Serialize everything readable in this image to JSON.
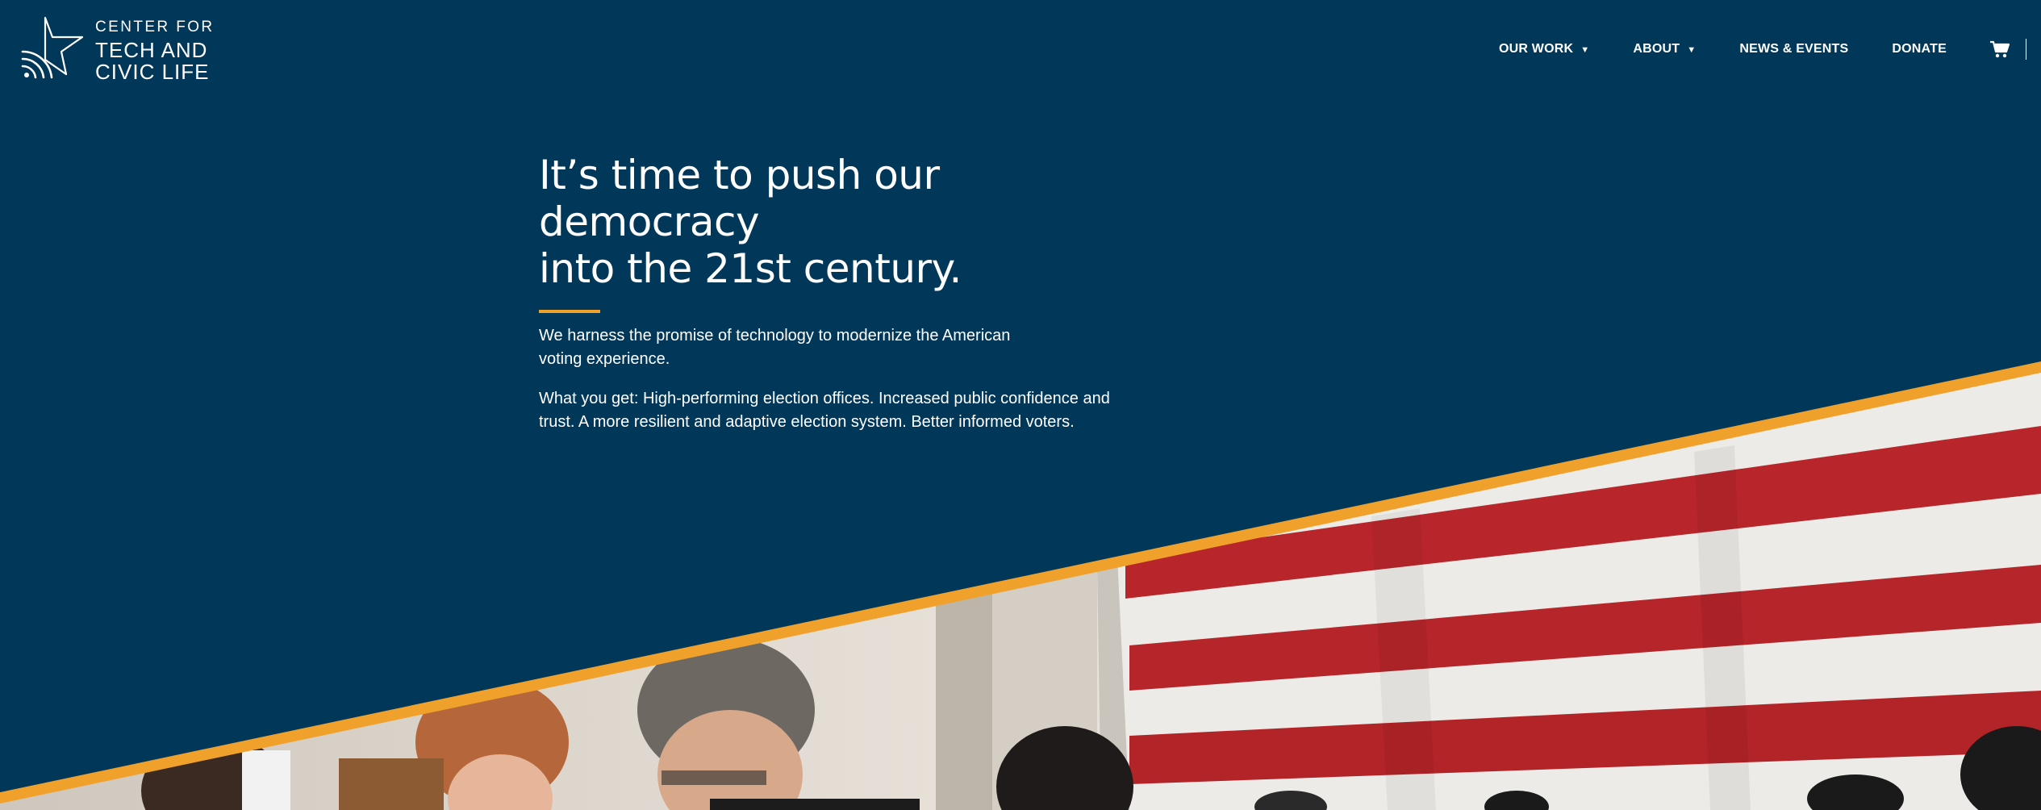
{
  "header": {
    "logo": {
      "line1": "CENTER FOR",
      "line2": "TECH AND",
      "line3": "CIVIC LIFE"
    },
    "nav": [
      {
        "label": "OUR WORK",
        "arrow": "▼"
      },
      {
        "label": "ABOUT",
        "arrow": "▼"
      },
      {
        "label": "NEWS & EVENTS"
      },
      {
        "label": "DONATE"
      }
    ],
    "icons": {
      "cart": "cart-icon",
      "search": "search-icon"
    }
  },
  "hero": {
    "title_line1": "It’s time to push our democracy",
    "title_line2": "into the 21st century.",
    "paragraph1": "We harness the promise of technology to modernize the American voting experience.",
    "paragraph2": "What you get: High-performing election offices. Increased public confidence and trust. A more resilient and adaptive election system. Better informed voters."
  },
  "colors": {
    "background": "#01385a",
    "accent": "#f0a12b",
    "text": "#ffffff"
  }
}
